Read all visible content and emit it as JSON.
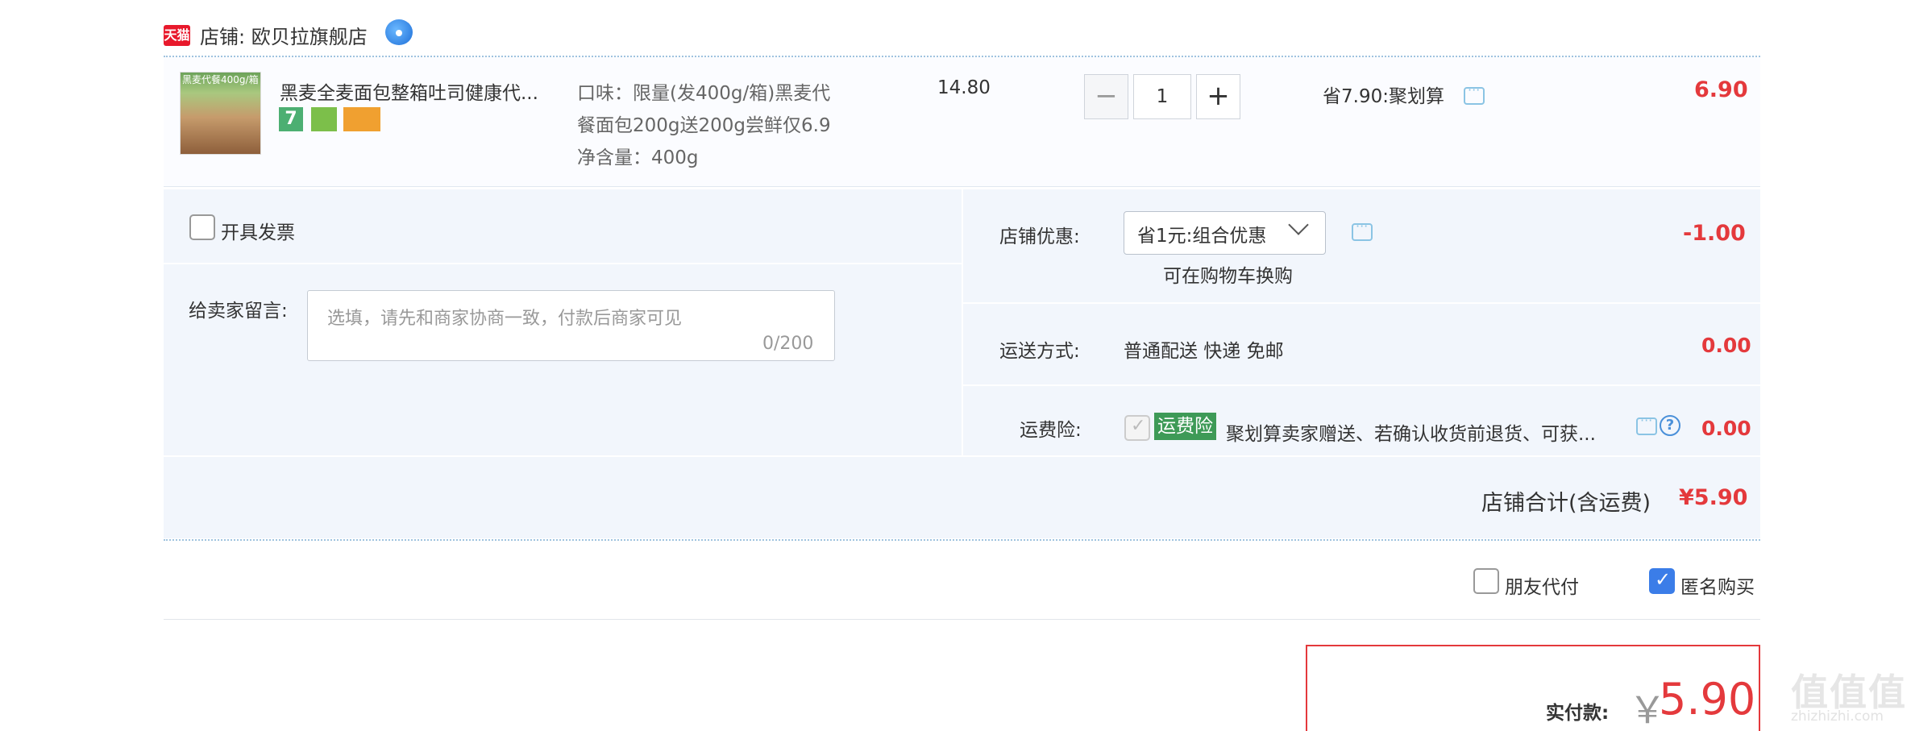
{
  "store": {
    "tmall_badge": "天猫",
    "label": "店铺: 欧贝拉旗舰店"
  },
  "item": {
    "thumb_text": "黑麦代餐400g/箱",
    "title": "黑麦全麦面包整箱吐司健康代...",
    "badge_seven": "7",
    "sku_line1": "口味：限量(发400g/箱)黑麦代",
    "sku_line2": "餐面包200g送200g尝鲜仅6.9",
    "sku_line3": "净含量：400g",
    "unit_price": "14.80",
    "quantity": "1",
    "minus": "−",
    "plus": "+",
    "promo": "省7.90:聚划算",
    "total": "6.90"
  },
  "invoice": {
    "label": "开具发票"
  },
  "note": {
    "label": "给卖家留言:",
    "placeholder": "选填，请先和商家协商一致，付款后商家可见",
    "count": "0/200"
  },
  "discount": {
    "label": "店铺优惠:",
    "selected": "省1元:组合优惠",
    "cart_link": "可在购物车换购",
    "value": "-1.00"
  },
  "shipping": {
    "label": "运送方式:",
    "method": "普通配送 快递 免邮",
    "value": "0.00"
  },
  "insurance": {
    "label": "运费险:",
    "tag": "运费险",
    "text": "聚划算卖家赠送、若确认收货前退货、可获...",
    "help": "?",
    "value": "0.00"
  },
  "subtotal": {
    "label": "店铺合计(含运费)",
    "value": "¥5.90"
  },
  "options": {
    "friend_pay": "朋友代付",
    "anonymous": "匿名购买"
  },
  "payment": {
    "label": "实付款:",
    "currency": "￥",
    "amount": "5.90"
  },
  "watermark": {
    "main": "值值值",
    "sub": "zhizhizhi.com"
  }
}
